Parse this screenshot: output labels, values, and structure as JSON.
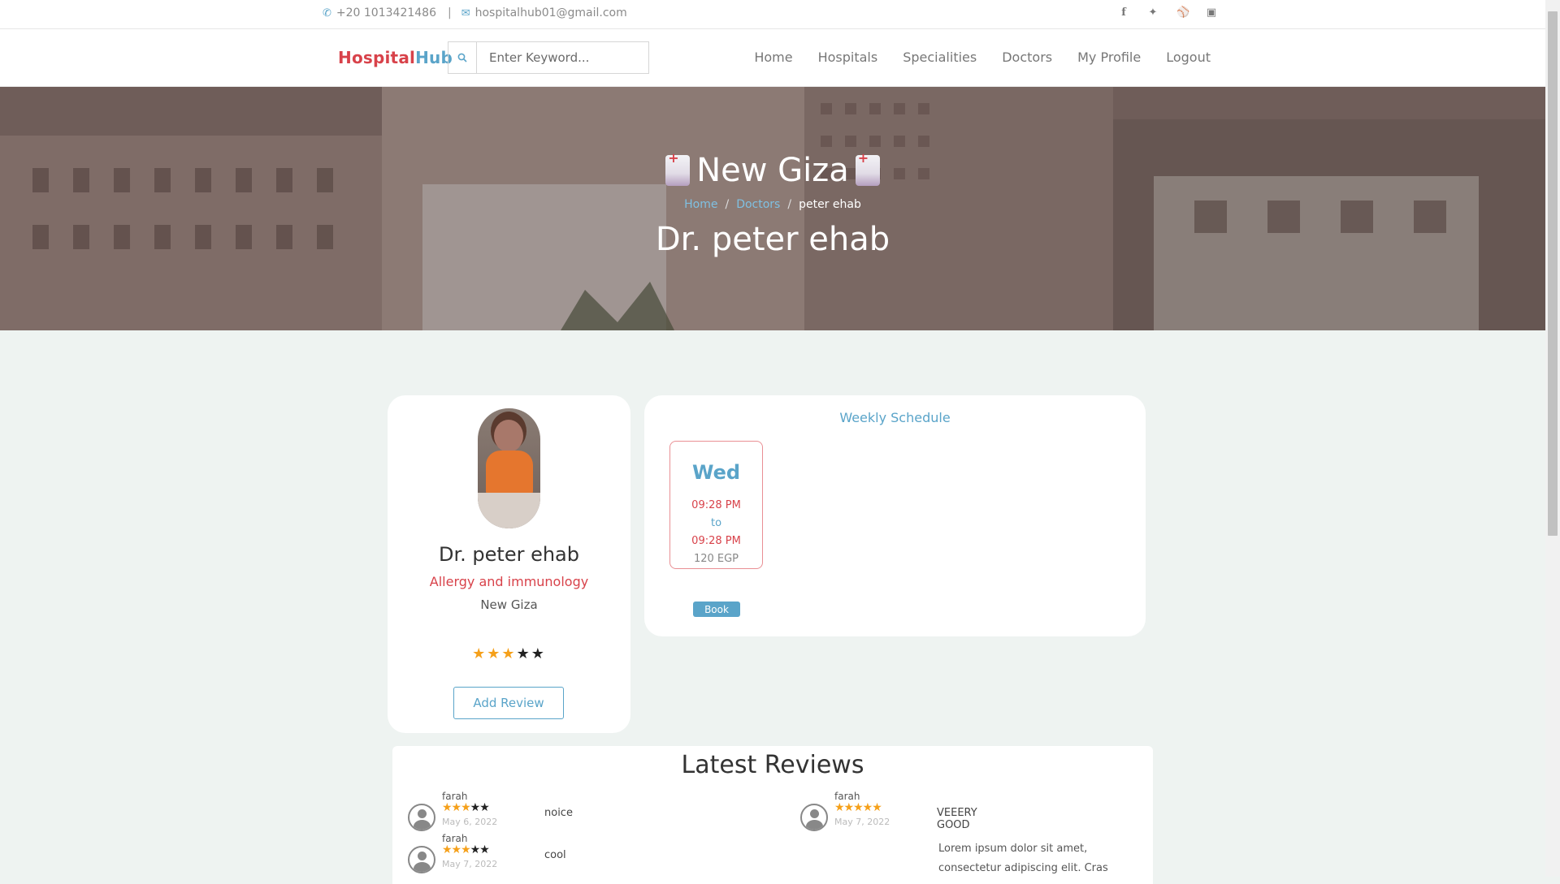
{
  "topbar": {
    "phone": "+20 1013421486",
    "separator": "|",
    "email": "hospitalhub01@gmail.com",
    "social": [
      "facebook-icon",
      "twitter-icon",
      "dribbble-icon",
      "instagram-icon"
    ]
  },
  "brand": {
    "part1": "Hospital",
    "part2": "Hub"
  },
  "search": {
    "placeholder": "Enter Keyword..."
  },
  "menu": [
    "Home",
    "Hospitals",
    "Specialities",
    "Doctors",
    "My Profile",
    "Logout"
  ],
  "hero": {
    "hospital": "New Giza",
    "breadcrumb": [
      "Home",
      "Doctors",
      "peter ehab"
    ],
    "doctor_title": "Dr. peter ehab"
  },
  "profile": {
    "name": "Dr. peter ehab",
    "speciality": "Allergy and immunology",
    "hospital": "New Giza",
    "rating": 3,
    "rating_max": 5,
    "add_review_label": "Add Review"
  },
  "schedule": {
    "title": "Weekly Schedule",
    "slots": [
      {
        "day": "Wed",
        "from": "09:28 PM",
        "to_label": "to",
        "to": "09:28 PM",
        "price": "120 EGP",
        "book_label": "Book"
      }
    ]
  },
  "reviews": {
    "title": "Latest Reviews",
    "items": [
      {
        "user": "farah",
        "rating": 3,
        "date": "May 6, 2022",
        "text": "noice"
      },
      {
        "user": "farah",
        "rating": 3,
        "date": "May 7, 2022",
        "text": "cool"
      },
      {
        "user": "farah",
        "rating": 5,
        "date": "May 7, 2022",
        "text": "VEEERY GOOD"
      }
    ],
    "lorem": "Lorem ipsum dolor sit amet, consectetur adipiscing elit. Cras"
  },
  "colors": {
    "brand_red": "#d8424a",
    "accent_blue": "#5aa4c9",
    "star": "#f5a01a",
    "page_bg": "#eef3f1"
  }
}
